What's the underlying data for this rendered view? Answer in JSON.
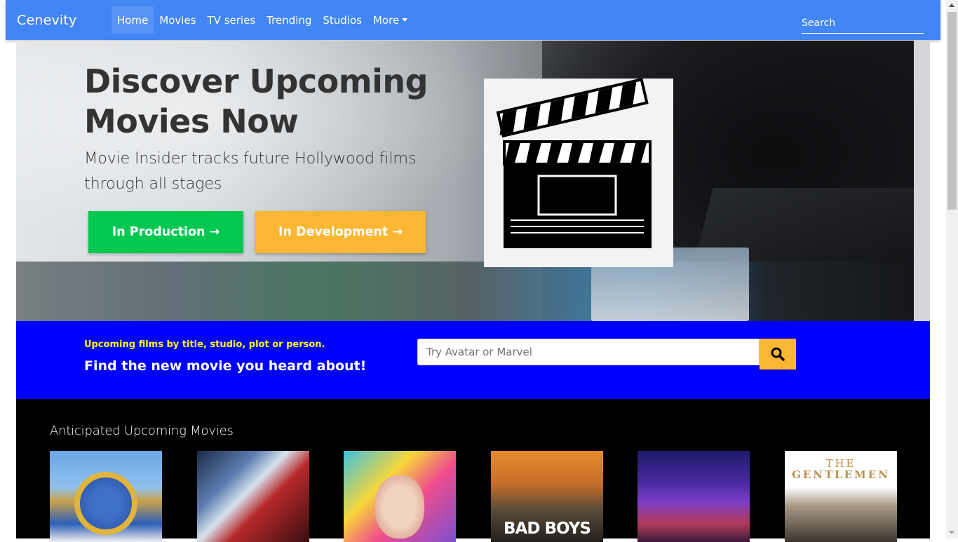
{
  "nav": {
    "brand": "Cenevity",
    "items": [
      {
        "label": "Home",
        "active": true
      },
      {
        "label": "Movies"
      },
      {
        "label": "TV series"
      },
      {
        "label": "Trending"
      },
      {
        "label": "Studios"
      },
      {
        "label": "More"
      }
    ],
    "search_placeholder": "Search"
  },
  "hero": {
    "title": "Discover Upcoming Movies Now",
    "subtitle": "Movie Insider tracks future Hollywood films through all stages",
    "buttons": {
      "production": "In Production →",
      "development": "In Development →"
    },
    "image_icon": "clapperboard-icon"
  },
  "search_band": {
    "small": "Upcoming films by title, studio, plot or person.",
    "big": "Find the new movie you heard about!",
    "placeholder": "Try Avatar or Marvel",
    "button_icon": "search-icon"
  },
  "movies": {
    "title": "Anticipated Upcoming Movies",
    "posters": [
      {
        "name": "poster-sonic",
        "text": ""
      },
      {
        "name": "poster-star-wars",
        "text": ""
      },
      {
        "name": "poster-birds-of-prey",
        "text": ""
      },
      {
        "name": "poster-bad-boys",
        "text": "BAD BOYS"
      },
      {
        "name": "poster-avengers",
        "text": ""
      },
      {
        "name": "poster-the-gentlemen",
        "text_line1": "THE",
        "text_line2": "GENTLEMEN"
      }
    ]
  },
  "colors": {
    "navbar": "#4285f4",
    "production": "#00c851",
    "development": "#fbb633",
    "band": "#0000ff",
    "band_small_text": "#ffff00"
  }
}
